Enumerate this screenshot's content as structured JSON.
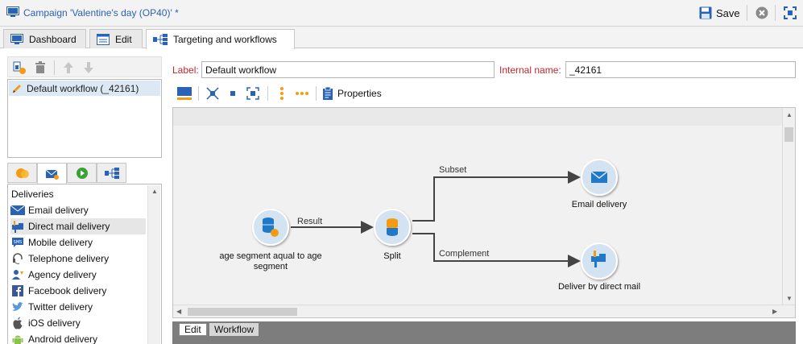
{
  "window": {
    "title": "Campaign 'Valentine's day (OP40)' *",
    "save_label": "Save"
  },
  "tabs": [
    {
      "label": "Dashboard"
    },
    {
      "label": "Edit"
    },
    {
      "label": "Targeting and workflows"
    }
  ],
  "workflow_list": {
    "items": [
      {
        "label": "Default workflow (_42161)"
      }
    ]
  },
  "palette": {
    "header": "Deliveries",
    "items": [
      {
        "label": "Email delivery",
        "icon": "envelope-icon"
      },
      {
        "label": "Direct mail delivery",
        "icon": "mailbox-icon"
      },
      {
        "label": "Mobile delivery",
        "icon": "sms-icon"
      },
      {
        "label": "Telephone delivery",
        "icon": "headset-icon"
      },
      {
        "label": "Agency delivery",
        "icon": "agency-icon"
      },
      {
        "label": "Facebook delivery",
        "icon": "facebook-icon"
      },
      {
        "label": "Twitter delivery",
        "icon": "twitter-icon"
      },
      {
        "label": "iOS delivery",
        "icon": "apple-icon"
      },
      {
        "label": "Android delivery",
        "icon": "android-icon"
      }
    ],
    "selected": "Direct mail delivery"
  },
  "form": {
    "label_caption": "Label:",
    "label_value": "Default workflow",
    "internal_name_caption": "Internal name:",
    "internal_name_value": "_42161"
  },
  "toolbar": {
    "properties_label": "Properties"
  },
  "workflow": {
    "nodes": [
      {
        "label": "age segment aqual to age segment"
      },
      {
        "label": "Split"
      },
      {
        "label": "Email delivery"
      },
      {
        "label": "Deliver by direct mail"
      }
    ],
    "edges": [
      {
        "label": "Result"
      },
      {
        "label": "Subset"
      },
      {
        "label": "Complement"
      }
    ]
  },
  "bottom_tabs": [
    {
      "label": "Edit"
    },
    {
      "label": "Workflow"
    }
  ],
  "colors": {
    "accent_blue": "#2a62b8",
    "node_fill": "#cfe0ef",
    "node_icon": "#1f78c8",
    "orange": "#f39c12",
    "required_red": "#c0272d"
  }
}
